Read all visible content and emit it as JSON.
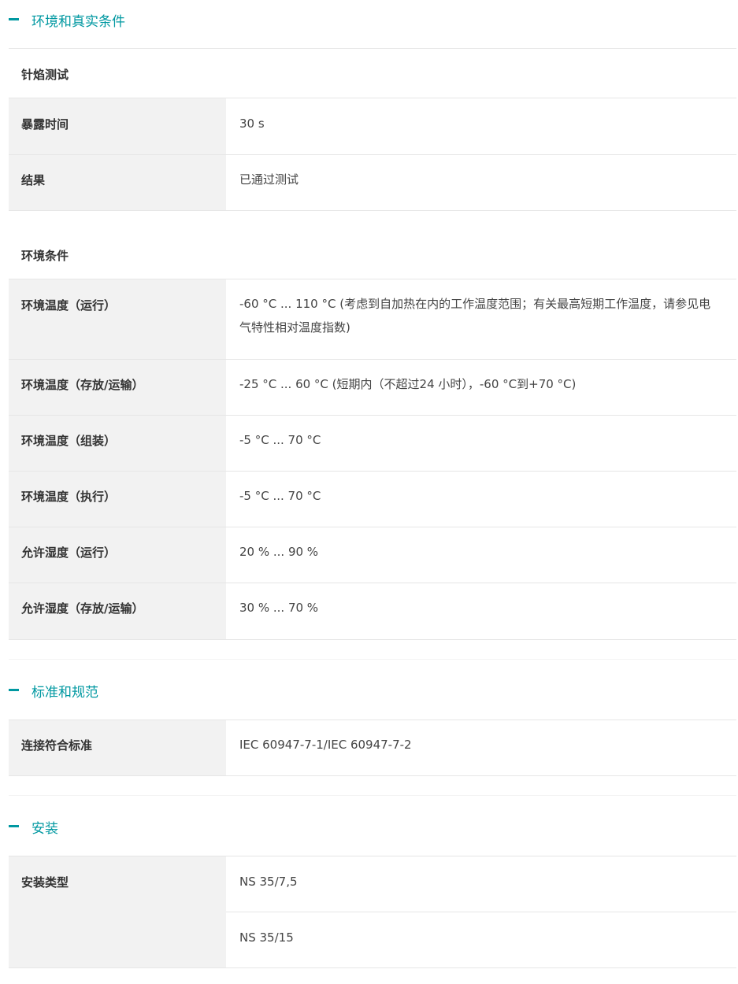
{
  "sections": {
    "environment": {
      "title": "环境和真实条件",
      "glow_wire": {
        "title": "针焰测试",
        "rows": [
          {
            "label": "暴露时间",
            "value": "30 s"
          },
          {
            "label": "结果",
            "value": "已通过测试"
          }
        ]
      },
      "ambient": {
        "title": "环境条件",
        "rows": [
          {
            "label": "环境温度（运行）",
            "value": "-60 °C ... 110 °C (考虑到自加热在内的工作温度范围；有关最高短期工作温度，请参见电气特性相对温度指数)"
          },
          {
            "label": "环境温度（存放/运输）",
            "value": "-25 °C ... 60 °C (短期内（不超过24  小时），-60 °C到+70 °C)"
          },
          {
            "label": "环境温度（组装）",
            "value": "-5 °C ... 70 °C"
          },
          {
            "label": "环境温度（执行）",
            "value": "-5 °C ... 70 °C"
          },
          {
            "label": "允许湿度（运行）",
            "value": "20 % ... 90 %"
          },
          {
            "label": "允许湿度（存放/运输）",
            "value": "30 % ... 70 %"
          }
        ]
      }
    },
    "standards": {
      "title": "标准和规范",
      "rows": [
        {
          "label": "连接符合标准",
          "value": "IEC 60947-7-1/IEC 60947-7-2"
        }
      ]
    },
    "mounting": {
      "title": "安装",
      "rows": [
        {
          "label": "安装类型",
          "values": [
            "NS 35/7,5",
            "NS 35/15"
          ]
        }
      ]
    }
  },
  "colors": {
    "accent": "#0098a1",
    "label_bg": "#f2f2f2",
    "divider": "#e6e6e6"
  }
}
